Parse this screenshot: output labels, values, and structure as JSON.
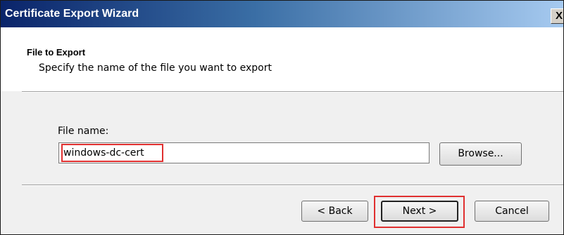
{
  "window": {
    "title": "Certificate Export Wizard",
    "close_label": "X"
  },
  "header": {
    "title": "File to Export",
    "subtitle": "Specify the name of the file you want to export"
  },
  "file_field": {
    "label": "File name:",
    "value": "windows-dc-cert"
  },
  "buttons": {
    "browse": "Browse...",
    "back": "< Back",
    "next": "Next >",
    "cancel": "Cancel"
  },
  "colors": {
    "highlight": "#e03030",
    "title_bar_start": "#0a246a",
    "title_bar_end": "#a6caf0"
  }
}
